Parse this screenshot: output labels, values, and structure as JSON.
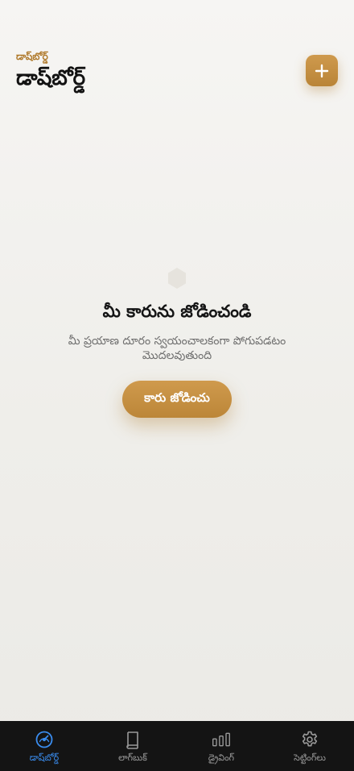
{
  "header": {
    "eyebrow": "డాష్‌బోర్డ్",
    "title": "డాష్‌బోర్డ్",
    "add_icon": "plus-icon"
  },
  "empty_state": {
    "icon": "hexagon-icon",
    "title": "మీ కారును జోడించండి",
    "description": "మీ ప్రయాణ దూరం స్వయంచాలకంగా పోగుపడటం మొదలవుతుంది",
    "button_label": "కారు జోడించు"
  },
  "tabs": [
    {
      "label": "డాష్‌బోర్డ్",
      "icon": "speedometer-icon",
      "active": true
    },
    {
      "label": "లాగ్‌బుక్",
      "icon": "book-icon",
      "active": false
    },
    {
      "label": "డ్రైవింగ్",
      "icon": "bar-chart-icon",
      "active": false
    },
    {
      "label": "సెట్టింగ్‌లు",
      "icon": "gear-icon",
      "active": false
    }
  ],
  "colors": {
    "accent": "#c48f41",
    "eyebrow": "#b07a2c",
    "active_tab": "#3a8df0",
    "inactive_tab": "#9a9a9a",
    "tabbar_bg": "#141414"
  }
}
